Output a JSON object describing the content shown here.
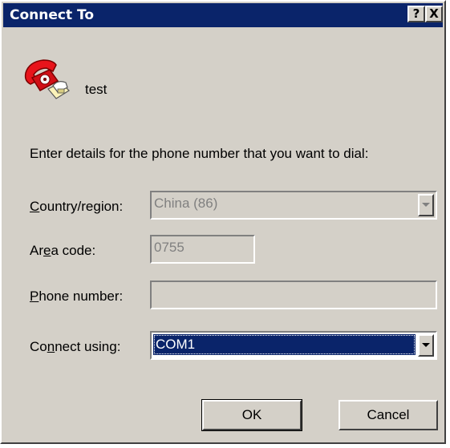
{
  "window": {
    "title": "Connect To",
    "help_button": "?",
    "close_button": "X"
  },
  "connection": {
    "name": "test",
    "icon": "phone-connection-icon"
  },
  "instruction": "Enter details for the phone number that you want to dial:",
  "fields": {
    "country": {
      "label_mnemonic": "C",
      "label_rest": "ountry/region:",
      "value": "China (86)"
    },
    "area_code": {
      "label_pre": "Ar",
      "label_mnemonic": "e",
      "label_post": "a code:",
      "value": "0755"
    },
    "phone_number": {
      "label_mnemonic": "P",
      "label_rest": "hone number:",
      "value": ""
    },
    "connect_using": {
      "label_pre": "Co",
      "label_mnemonic": "n",
      "label_post": "nect using:",
      "value": "COM1"
    }
  },
  "buttons": {
    "ok": "OK",
    "cancel": "Cancel"
  }
}
